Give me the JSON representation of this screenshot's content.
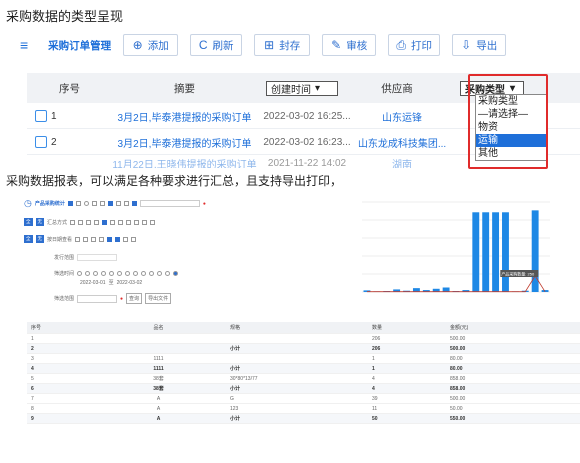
{
  "title1": "采购数据的类型呈现",
  "toolbar": {
    "menu_icon": "≡",
    "title": "采购订单管理",
    "buttons": [
      {
        "icon": "⊕",
        "label": "添加"
      },
      {
        "icon": "C",
        "label": "刷新"
      },
      {
        "icon": "⊞",
        "label": "封存"
      },
      {
        "icon": "✎",
        "label": "审核"
      },
      {
        "icon": "⎙",
        "label": "打印"
      },
      {
        "icon": "⇩",
        "label": "导出"
      }
    ]
  },
  "table": {
    "headers": {
      "no": "序号",
      "summary": "摘要",
      "created": "创建时间",
      "supplier": "供应商",
      "type": "采购类型"
    },
    "rows": [
      {
        "no": "1",
        "summary": "3月2日,毕泰港提报的采购订单",
        "created": "2022-03-02 16:25...",
        "supplier": "山东运锋",
        "type": "运输"
      },
      {
        "no": "2",
        "summary": "3月2日,毕泰港提报的采购订单",
        "created": "2022-03-02 16:23...",
        "supplier": "山东龙成科技集团...",
        "type": "物资"
      }
    ],
    "partial": {
      "summary": "11月22日,王晓伟提报的采购订单",
      "created": "2021-11-22 14:02",
      "supplier": "湖南"
    }
  },
  "dropdown": {
    "selected": "采购类型",
    "options": [
      "采购类型",
      "—请选择—",
      "物资",
      "运输",
      "其他"
    ],
    "highlighted": "运输"
  },
  "title2": "采购数据报表，可以满足各种要求进行汇总，且支持导出打印，",
  "panel": {
    "title": "产品采购统计",
    "rows": [
      "汇总方式",
      "按日期查看",
      "发行范围",
      "筛选时间",
      "筛选范围"
    ],
    "date_from": "2022-03-01",
    "date_to": "2022-03-02",
    "search_btn": "查询",
    "export_btn": "导出文件"
  },
  "chart_data": {
    "type": "bar",
    "values": [
      5,
      2,
      3,
      8,
      4,
      12,
      6,
      10,
      14,
      3,
      6,
      248,
      248,
      248,
      248,
      2,
      4,
      254,
      6
    ],
    "line": [
      1,
      1,
      1,
      1,
      1,
      1,
      1,
      1,
      1,
      1,
      1,
      1,
      1,
      1,
      1,
      1,
      1,
      50,
      1
    ],
    "ylim": [
      0,
      280
    ],
    "tooltip": "产品采购数量: 250"
  },
  "report": {
    "headers": [
      "序号",
      "品名",
      "规格",
      "数量",
      "金额(元)"
    ],
    "rows": [
      [
        "1",
        "",
        "",
        "206",
        "500.00"
      ],
      [
        "2",
        "",
        "小计",
        "206",
        "500.00"
      ],
      [
        "3",
        "1111",
        "",
        "1",
        "80.00"
      ],
      [
        "4",
        "1111",
        "小计",
        "1",
        "80.00"
      ],
      [
        "5",
        "38套",
        "30*80*13/77",
        "4",
        "858.00"
      ],
      [
        "6",
        "38套",
        "小计",
        "4",
        "858.00"
      ],
      [
        "7",
        "A",
        "G",
        "39",
        "500.00"
      ],
      [
        "8",
        "A",
        "123",
        "11",
        "50.00"
      ],
      [
        "9",
        "A",
        "小计",
        "50",
        "550.00"
      ]
    ],
    "sub_rows": [
      1,
      3,
      5,
      8
    ]
  }
}
